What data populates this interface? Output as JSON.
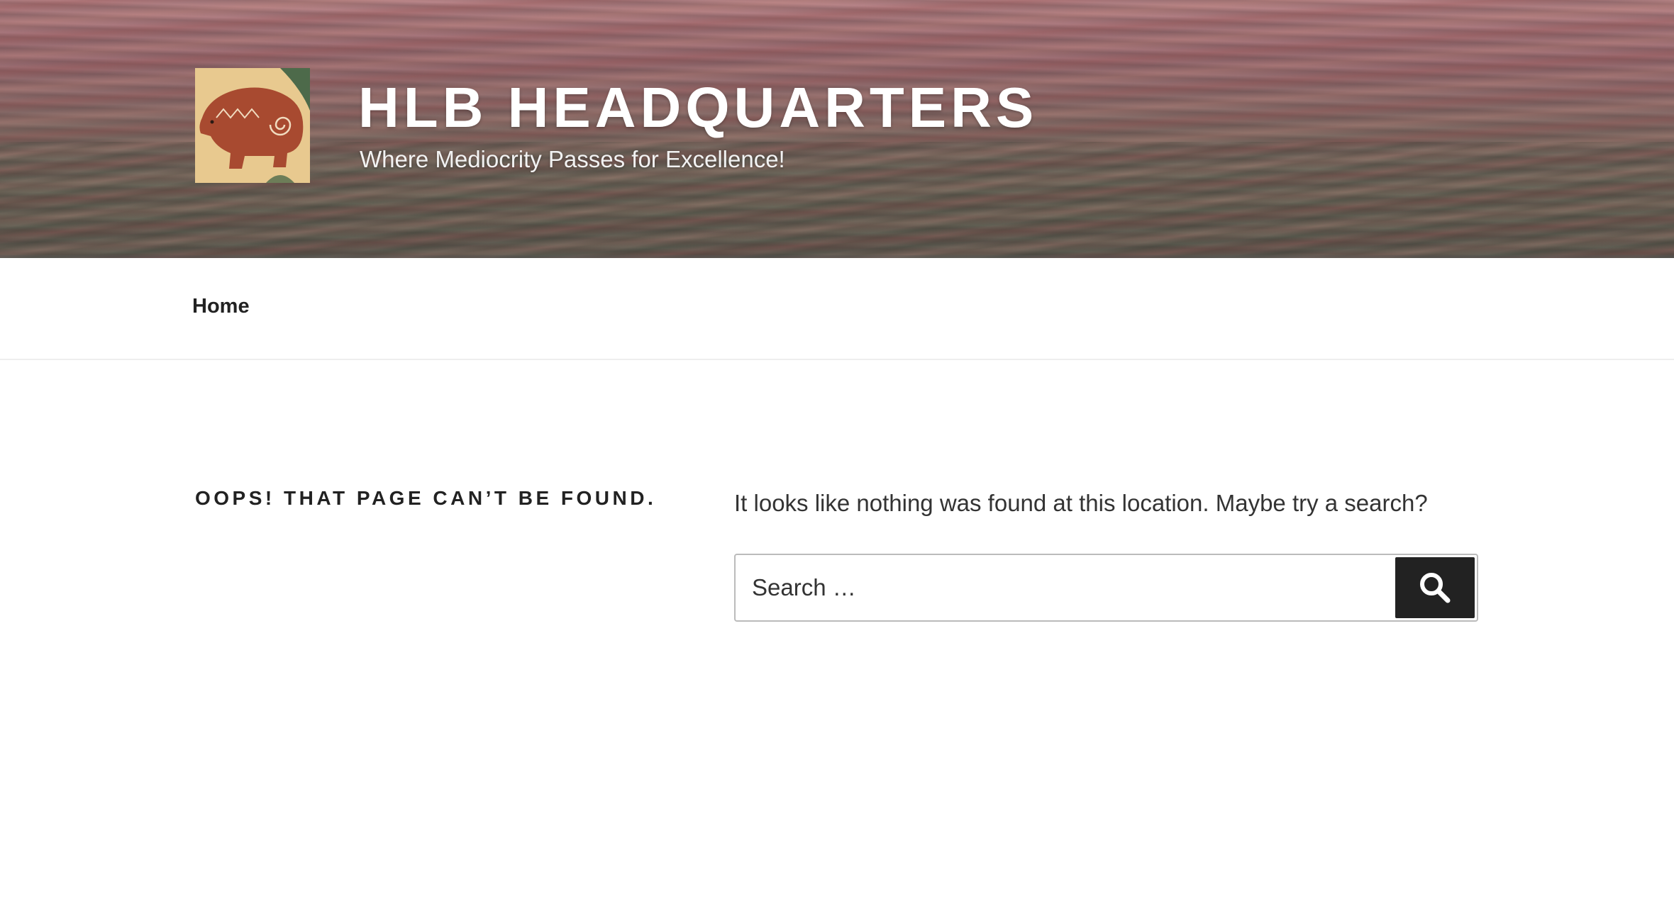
{
  "header": {
    "site_title": "HLB HEADQUARTERS",
    "site_description": "Where Mediocrity Passes for Excellence!",
    "logo_icon": "bear-icon"
  },
  "nav": {
    "items": [
      {
        "label": "Home"
      }
    ]
  },
  "main": {
    "page_title": "OOPS! THAT PAGE CAN’T BE FOUND.",
    "message": "It looks like nothing was found at this location. Maybe try a search?",
    "search": {
      "placeholder": "Search …",
      "value": "",
      "submit_icon": "search-icon"
    }
  },
  "colors": {
    "text": "#222222",
    "button_bg": "#222222",
    "logo_bg": "#e8c98f",
    "bear": "#a84a30"
  }
}
